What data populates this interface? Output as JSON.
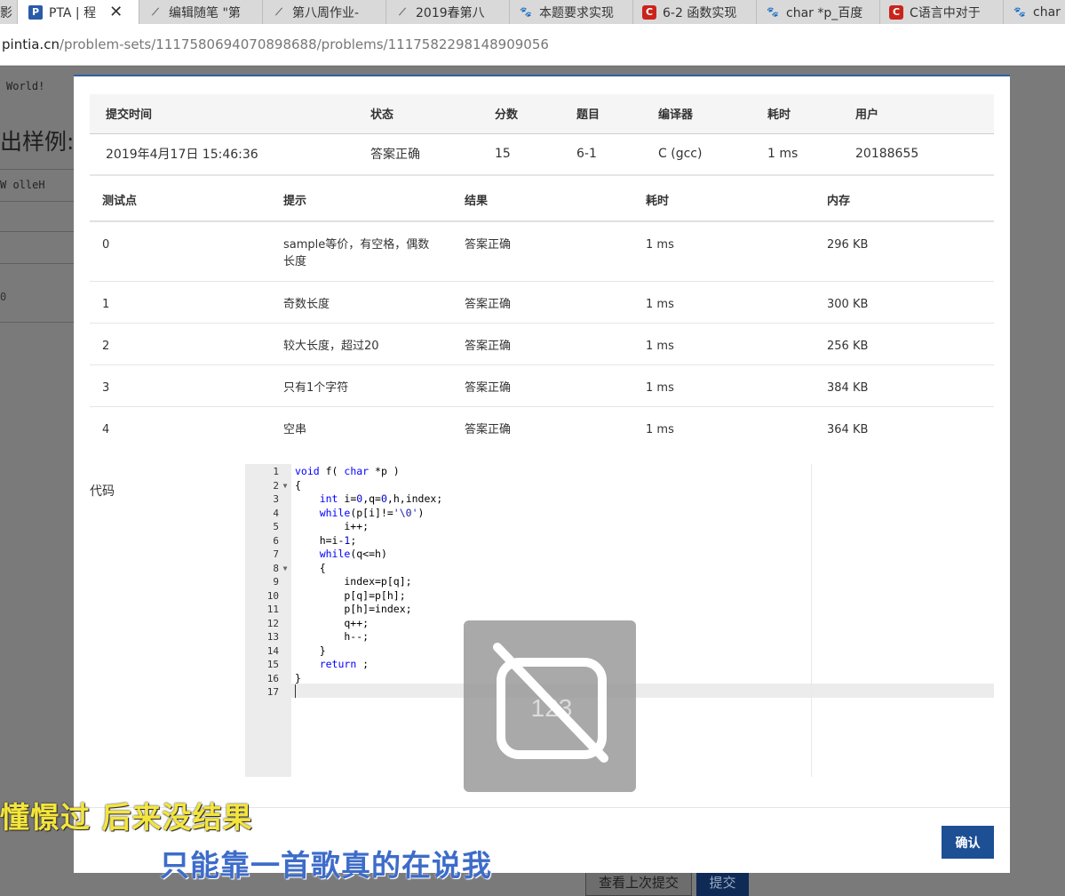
{
  "browser": {
    "tabs": [
      {
        "label": "PTA | 程",
        "icon": "pta-icon",
        "active": true
      },
      {
        "label": "编辑随笔 \"第",
        "icon": "feather-icon"
      },
      {
        "label": "第八周作业-",
        "icon": "feather-icon"
      },
      {
        "label": "2019春第八",
        "icon": "feather-icon"
      },
      {
        "label": "本题要求实现",
        "icon": "paw-icon"
      },
      {
        "label": "6-2 函数实现",
        "icon": "csdn-icon"
      },
      {
        "label": "char *p_百度",
        "icon": "paw-icon"
      },
      {
        "label": "C语言中对于",
        "icon": "csdn-icon"
      },
      {
        "label": "char",
        "icon": "paw-icon"
      }
    ],
    "first_tab_fragment": "影",
    "url_host": "pintia.cn",
    "url_path": "/problem-sets/1117580694070898688/problems/1117582298148909056"
  },
  "background_page": {
    "hello_world": "World!",
    "heading": "出样例:",
    "reversed": "W olleH",
    "digit": "0",
    "buttons": {
      "last_submission": "查看上次提交",
      "submit": "提交"
    }
  },
  "submission": {
    "headers": [
      "提交时间",
      "状态",
      "分数",
      "题目",
      "编译器",
      "耗时",
      "用户"
    ],
    "row": {
      "time": "2019年4月17日 15:46:36",
      "status": "答案正确",
      "score": "15",
      "problem": "6-1",
      "compiler": "C (gcc)",
      "duration": "1 ms",
      "user": "20188655"
    }
  },
  "tests": {
    "headers": [
      "测试点",
      "提示",
      "结果",
      "耗时",
      "内存"
    ],
    "rows": [
      {
        "id": "0",
        "hint": "sample等价，有空格，偶数长度",
        "result": "答案正确",
        "time": "1 ms",
        "memory": "296 KB"
      },
      {
        "id": "1",
        "hint": "奇数长度",
        "result": "答案正确",
        "time": "1 ms",
        "memory": "300 KB"
      },
      {
        "id": "2",
        "hint": "较大长度，超过20",
        "result": "答案正确",
        "time": "1 ms",
        "memory": "256 KB"
      },
      {
        "id": "3",
        "hint": "只有1个字符",
        "result": "答案正确",
        "time": "1 ms",
        "memory": "384 KB"
      },
      {
        "id": "4",
        "hint": "空串",
        "result": "答案正确",
        "time": "1 ms",
        "memory": "364 KB"
      }
    ]
  },
  "code": {
    "label": "代码",
    "line_numbers": [
      "1",
      "2",
      "3",
      "4",
      "5",
      "6",
      "7",
      "8",
      "9",
      "10",
      "11",
      "12",
      "13",
      "14",
      "15",
      "16",
      "17"
    ],
    "lines": [
      "void f( char *p )",
      "{",
      "    int i=0,q=0,h,index;",
      "    while(p[i]!='\\0')",
      "        i++;",
      "    h=i-1;",
      "    while(q<=h)",
      "    {",
      "        index=p[q];",
      "        p[q]=p[h];",
      "        p[h]=index;",
      "        q++;",
      "        h--;",
      "    }",
      "    return ;",
      "}",
      ""
    ]
  },
  "modal": {
    "confirm_label": "确认"
  },
  "overlay": {
    "icon": "no-number-keyboard-icon",
    "text": "123"
  },
  "lyrics": {
    "line1": "懂憬过 后来没结果",
    "line2": "只能靠一首歌真的在说我"
  },
  "colors": {
    "accent": "#1d4f95",
    "status_ok": "#e4393c",
    "link": "#2b62a8"
  }
}
